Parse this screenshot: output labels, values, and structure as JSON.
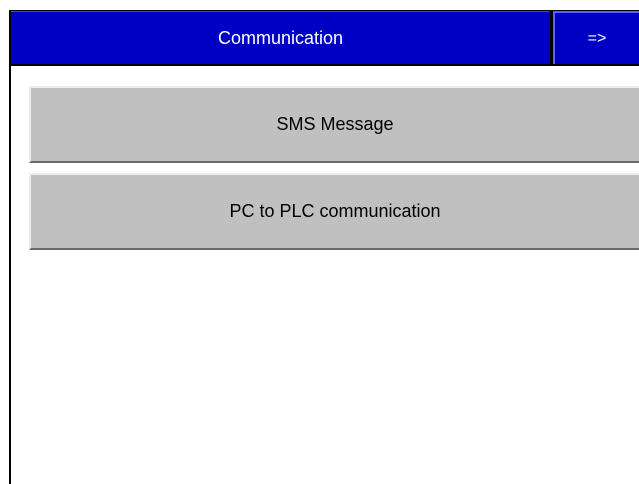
{
  "header": {
    "title": "Communication",
    "next_label": "=>"
  },
  "menu": {
    "items": [
      {
        "label": "SMS Message"
      },
      {
        "label": "PC to PLC communication"
      }
    ]
  },
  "colors": {
    "title_bar": "#0000c4",
    "button_face": "#c0c0c0",
    "background": "#ffffff"
  }
}
